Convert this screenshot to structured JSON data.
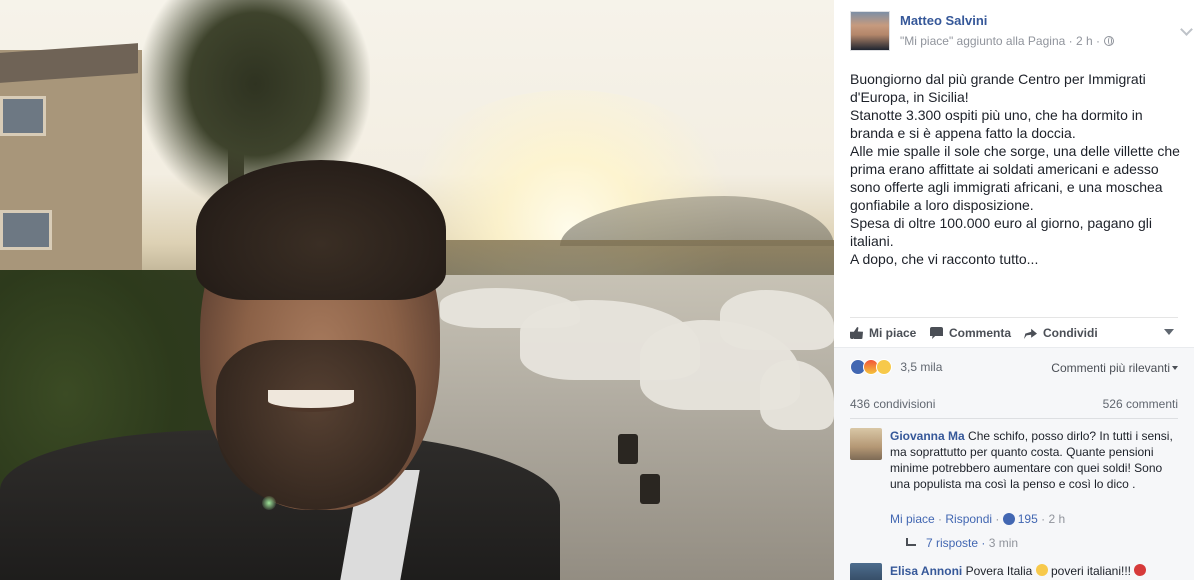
{
  "post": {
    "author": "Matteo Salvini",
    "meta": "\"Mi piace\" aggiunto alla Pagina · 2 h ·",
    "paragraphs": [
      "Buongiorno dal più grande Centro per Immigrati d'Europa, in Sicilia!",
      "Stanotte 3.300 ospiti più uno, che ha dormito in branda e si è appena fatto la doccia.",
      "Alle mie spalle il sole che sorge, una delle villette che prima erano affittate ai soldati americani e adesso sono offerte agli immigrati africani, e una moschea gonfiabile a loro disposizione.",
      "Spesa di oltre 100.000 euro al giorno, pagano gli italiani.",
      "A dopo, che vi racconto tutto..."
    ]
  },
  "actions": {
    "like": "Mi piace",
    "comment": "Commenta",
    "share": "Condividi"
  },
  "feedback": {
    "reaction_count": "3,5 mila",
    "sort_label": "Commenti più rilevanti",
    "shares": "436 condivisioni",
    "comments": "526 commenti"
  },
  "comments": [
    {
      "author": "Giovanna Ma",
      "text": "Che schifo, posso dirlo? In tutti i sensi, ma soprattutto per quanto costa. Quante pensioni minime potrebbero aumentare con quei soldi! Sono una populista ma così la penso e così lo dico .",
      "like_label": "Mi piace",
      "reply_label": "Rispondi",
      "likes": "195",
      "time": "2 h",
      "replies": "7 risposte",
      "replies_time": "3 min"
    },
    {
      "author": "Elisa Annoni",
      "text": "Povera Italia",
      "text_after_emoji": "poveri italiani!!!"
    }
  ],
  "icons": {
    "post_menu": "chevron-down-icon",
    "privacy": "globe-icon",
    "like": "like-icon",
    "comment": "comment-icon",
    "share": "share-icon",
    "reactions": [
      "like-react-icon",
      "angry-react-icon",
      "wow-react-icon"
    ]
  },
  "colors": {
    "link": "#365899",
    "accent": "#4267b2",
    "meta": "#90949c",
    "text": "#1d2129",
    "panel_bg": "#f6f7f9"
  }
}
